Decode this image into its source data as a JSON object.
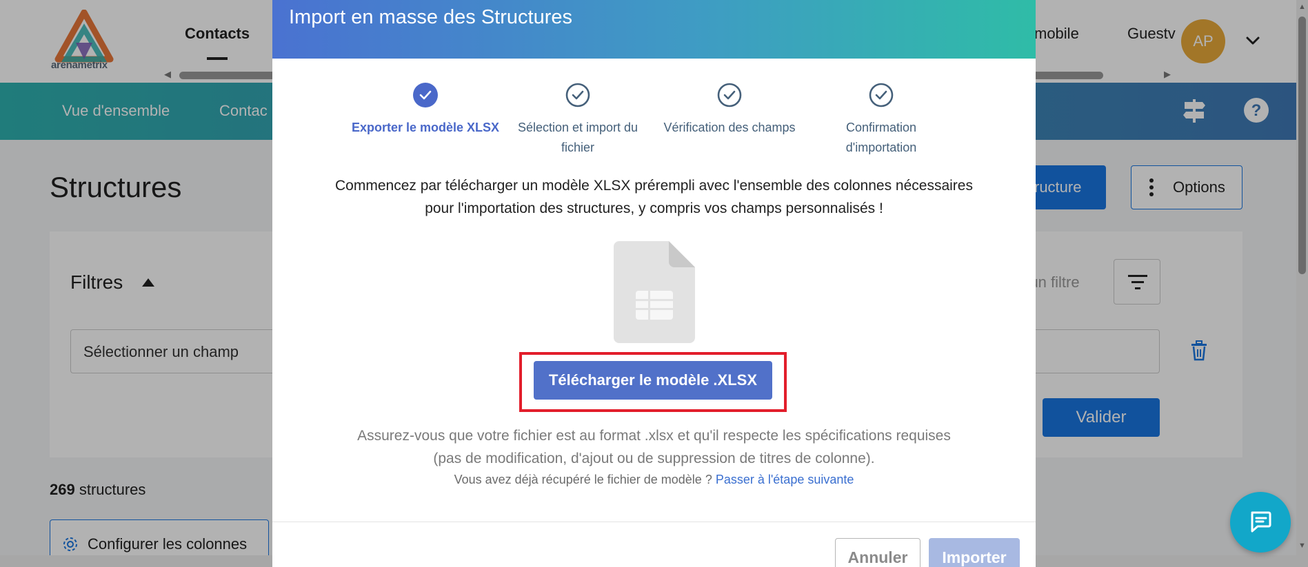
{
  "app": {
    "logo_text": "arenametrix"
  },
  "top_tabs": [
    {
      "label": "Contacts"
    },
    {
      "label": "mobile"
    },
    {
      "label": "Guestv"
    }
  ],
  "user": {
    "initials": "AP"
  },
  "nav": [
    {
      "label": "Vue d'ensemble"
    },
    {
      "label": "Contac"
    }
  ],
  "page": {
    "title": "Structures",
    "new_structure_label": "ructure",
    "options_label": "Options"
  },
  "filters": {
    "title": "Filtres",
    "field_placeholder": "Sélectionner un champ",
    "add_filter_hint": "r un filtre",
    "validate_label": "Valider"
  },
  "results": {
    "count": "269",
    "count_label": " structures"
  },
  "configure_columns_label": "Configurer les colonnes",
  "modal": {
    "title": "Import en masse des Structures",
    "steps": [
      {
        "label": "Exporter le modèle XLSX",
        "active": true
      },
      {
        "label": "Sélection et import du fichier",
        "active": false
      },
      {
        "label": "Vérification des champs",
        "active": false
      },
      {
        "label": "Confirmation d'importation",
        "active": false
      }
    ],
    "intro_line1": "Commencez par télécharger un modèle XLSX prérempli avec l'ensemble des colonnes nécessaires",
    "intro_line2": "pour l'importation des structures, y compris vos champs personnalisés !",
    "download_label": "Télécharger le modèle .XLSX",
    "note_line1": "Assurez-vous que votre fichier est au format .xlsx et qu'il respecte les spécifications requises",
    "note_line2": "(pas de modification, d'ajout ou de suppression de titres de colonne).",
    "skip_text": "Vous avez déjà récupéré le fichier de modèle ? ",
    "skip_link": "Passer à l'étape suivante",
    "cancel_label": "Annuler",
    "import_label": "Importer"
  },
  "colors": {
    "primary": "#1976e1",
    "modal_accent": "#5171c9",
    "highlight": "#e21e2b",
    "nav_gradient_start": "#2fb2b0",
    "nav_gradient_end": "#3f79b6"
  },
  "icons": [
    "arenametrix-logo",
    "chevron-down-icon",
    "signpost-icon",
    "help-icon",
    "kebab-menu-icon",
    "caret-up-icon",
    "filter-lines-icon",
    "trash-icon",
    "gear-icon",
    "chat-icon",
    "check-circle-icon",
    "spreadsheet-file-icon"
  ]
}
